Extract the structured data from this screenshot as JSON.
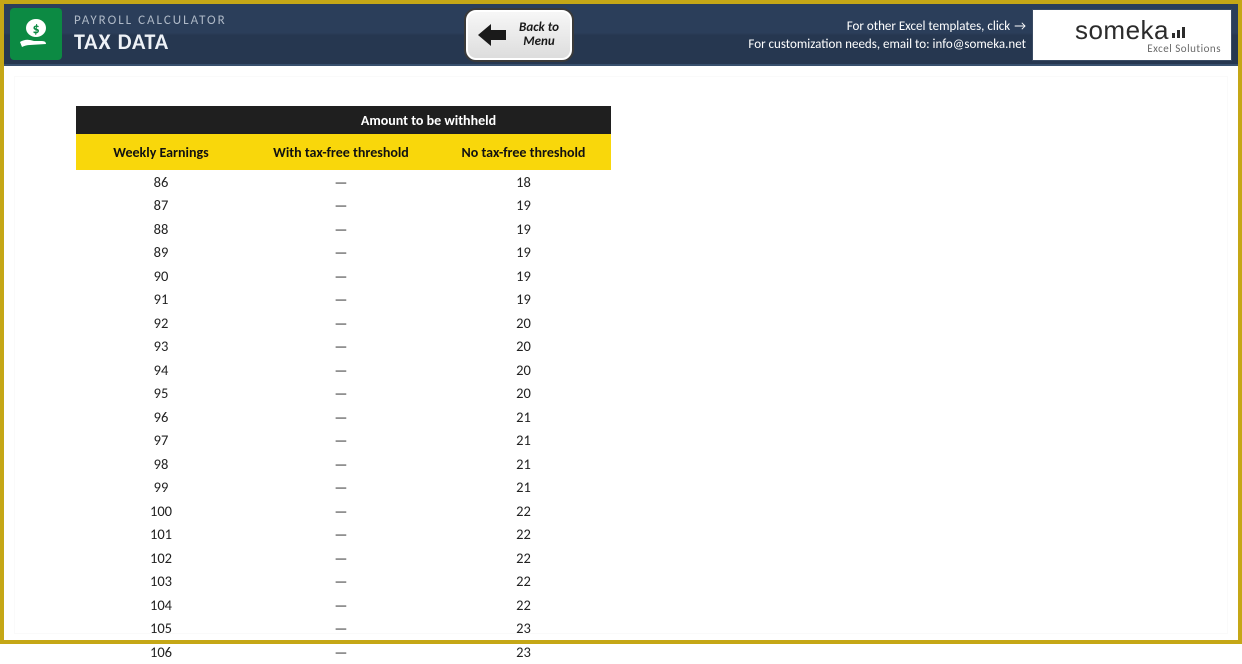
{
  "header": {
    "subtitle": "PAYROLL CALCULATOR",
    "title": "TAX DATA",
    "back_button_label": "Back to Menu",
    "info_line1": "For other Excel templates, click",
    "info_line2": "For customization needs, email to: info@someka.net",
    "someka_brand": "someka",
    "someka_tag": "Excel Solutions"
  },
  "table": {
    "header_merge": "Amount to be withheld",
    "cols": [
      "Weekly Earnings",
      "With tax-free threshold",
      "No tax-free threshold"
    ],
    "rows": [
      {
        "earnings": "86",
        "with": "—",
        "without": "18"
      },
      {
        "earnings": "87",
        "with": "—",
        "without": "19"
      },
      {
        "earnings": "88",
        "with": "—",
        "without": "19"
      },
      {
        "earnings": "89",
        "with": "—",
        "without": "19"
      },
      {
        "earnings": "90",
        "with": "—",
        "without": "19"
      },
      {
        "earnings": "91",
        "with": "—",
        "without": "19"
      },
      {
        "earnings": "92",
        "with": "—",
        "without": "20"
      },
      {
        "earnings": "93",
        "with": "—",
        "without": "20"
      },
      {
        "earnings": "94",
        "with": "—",
        "without": "20"
      },
      {
        "earnings": "95",
        "with": "—",
        "without": "20"
      },
      {
        "earnings": "96",
        "with": "—",
        "without": "21"
      },
      {
        "earnings": "97",
        "with": "—",
        "without": "21"
      },
      {
        "earnings": "98",
        "with": "—",
        "without": "21"
      },
      {
        "earnings": "99",
        "with": "—",
        "without": "21"
      },
      {
        "earnings": "100",
        "with": "—",
        "without": "22"
      },
      {
        "earnings": "101",
        "with": "—",
        "without": "22"
      },
      {
        "earnings": "102",
        "with": "—",
        "without": "22"
      },
      {
        "earnings": "103",
        "with": "—",
        "without": "22"
      },
      {
        "earnings": "104",
        "with": "—",
        "without": "22"
      },
      {
        "earnings": "105",
        "with": "—",
        "without": "23"
      },
      {
        "earnings": "106",
        "with": "—",
        "without": "23"
      }
    ]
  }
}
